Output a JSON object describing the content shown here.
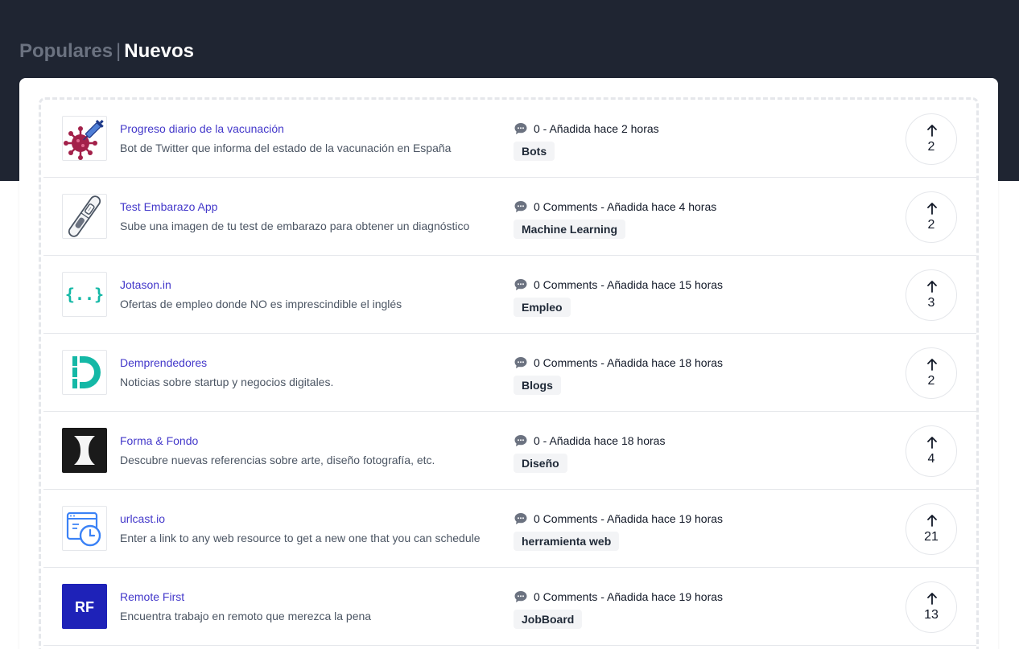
{
  "tabs": {
    "popular": "Populares",
    "separator": "|",
    "new": "Nuevos"
  },
  "items": [
    {
      "title": "Progreso diario de la vacunación",
      "description": "Bot de Twitter que informa del estado de la vacunación en España",
      "meta": "0 - Añadida hace 2 horas",
      "tag": "Bots",
      "votes": "2",
      "icon": "virus-syringe-icon"
    },
    {
      "title": "Test Embarazo App",
      "description": "Sube una imagen de tu test de embarazo para obtener un diagnóstico",
      "meta": "0 Comments - Añadida hace 4 horas",
      "tag": "Machine Learning",
      "votes": "2",
      "icon": "pregnancy-test-icon"
    },
    {
      "title": "Jotason.in",
      "description": "Ofertas de empleo donde NO es imprescindible el inglés",
      "meta": "0 Comments - Añadida hace 15 horas",
      "tag": "Empleo",
      "votes": "3",
      "icon": "curly-braces-icon"
    },
    {
      "title": "Demprendedores",
      "description": "Noticias sobre startup y negocios digitales.",
      "meta": "0 Comments - Añadida hace 18 horas",
      "tag": "Blogs",
      "votes": "2",
      "icon": "d-logo-icon"
    },
    {
      "title": "Forma & Fondo",
      "description": "Descubre nuevas referencias sobre arte, diseño fotografía, etc.",
      "meta": "0 - Añadida hace 18 horas",
      "tag": "Diseño",
      "votes": "4",
      "icon": "forma-fondo-logo-icon"
    },
    {
      "title": "urlcast.io",
      "description": "Enter a link to any web resource to get a new one that you can schedule",
      "meta": "0 Comments - Añadida hace 19 horas",
      "tag": "herramienta web",
      "votes": "21",
      "icon": "browser-clock-icon"
    },
    {
      "title": "Remote First",
      "description": "Encuentra trabajo en remoto que merezca la pena",
      "meta": "0 Comments - Añadida hace 19 horas",
      "tag": "JobBoard",
      "votes": "13",
      "icon": "rf-logo-icon",
      "logo_text": "RF"
    }
  ],
  "colors": {
    "header_bg": "#1f2532",
    "title_link": "#4338ca",
    "tag_bg": "#f3f4f6"
  }
}
